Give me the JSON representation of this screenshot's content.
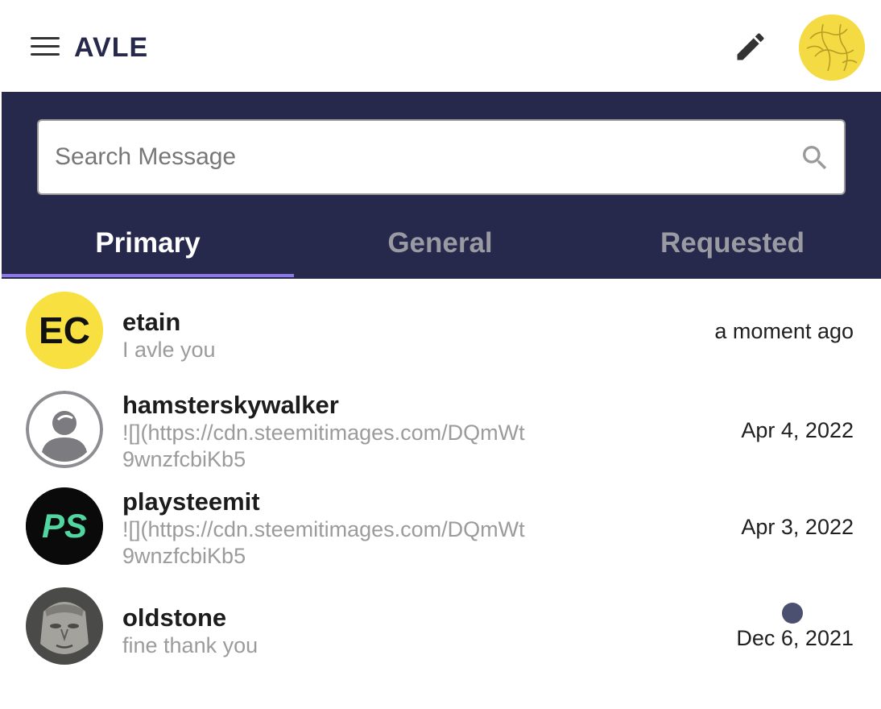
{
  "header": {
    "logo_text": "AVLE",
    "menu_icon": "hamburger-menu-icon",
    "compose_icon": "pencil-icon"
  },
  "search": {
    "placeholder": "Search Message",
    "value": ""
  },
  "tabs": [
    {
      "label": "Primary",
      "active": true
    },
    {
      "label": "General",
      "active": false
    },
    {
      "label": "Requested",
      "active": false
    }
  ],
  "conversations": [
    {
      "name": "etain",
      "preview": "I avle you",
      "time": "a moment ago",
      "avatar_text": "EC",
      "unread": false
    },
    {
      "name": "hamsterskywalker",
      "preview": "![](https://cdn.steemitimages.com/DQmWt9wnzfcbiKb5",
      "time": "Apr 4, 2022",
      "unread": false
    },
    {
      "name": "playsteemit",
      "preview": "![](https://cdn.steemitimages.com/DQmWt9wnzfcbiKb5",
      "time": "Apr 3, 2022",
      "avatar_text": "PS",
      "unread": false
    },
    {
      "name": "oldstone",
      "preview": "fine thank you",
      "time": "Dec 6, 2021",
      "unread": true
    }
  ],
  "colors": {
    "band": "#26294c",
    "tab_indicator": "#8d79e6",
    "logo": "#26294c",
    "unread_dot": "#4c5070"
  }
}
